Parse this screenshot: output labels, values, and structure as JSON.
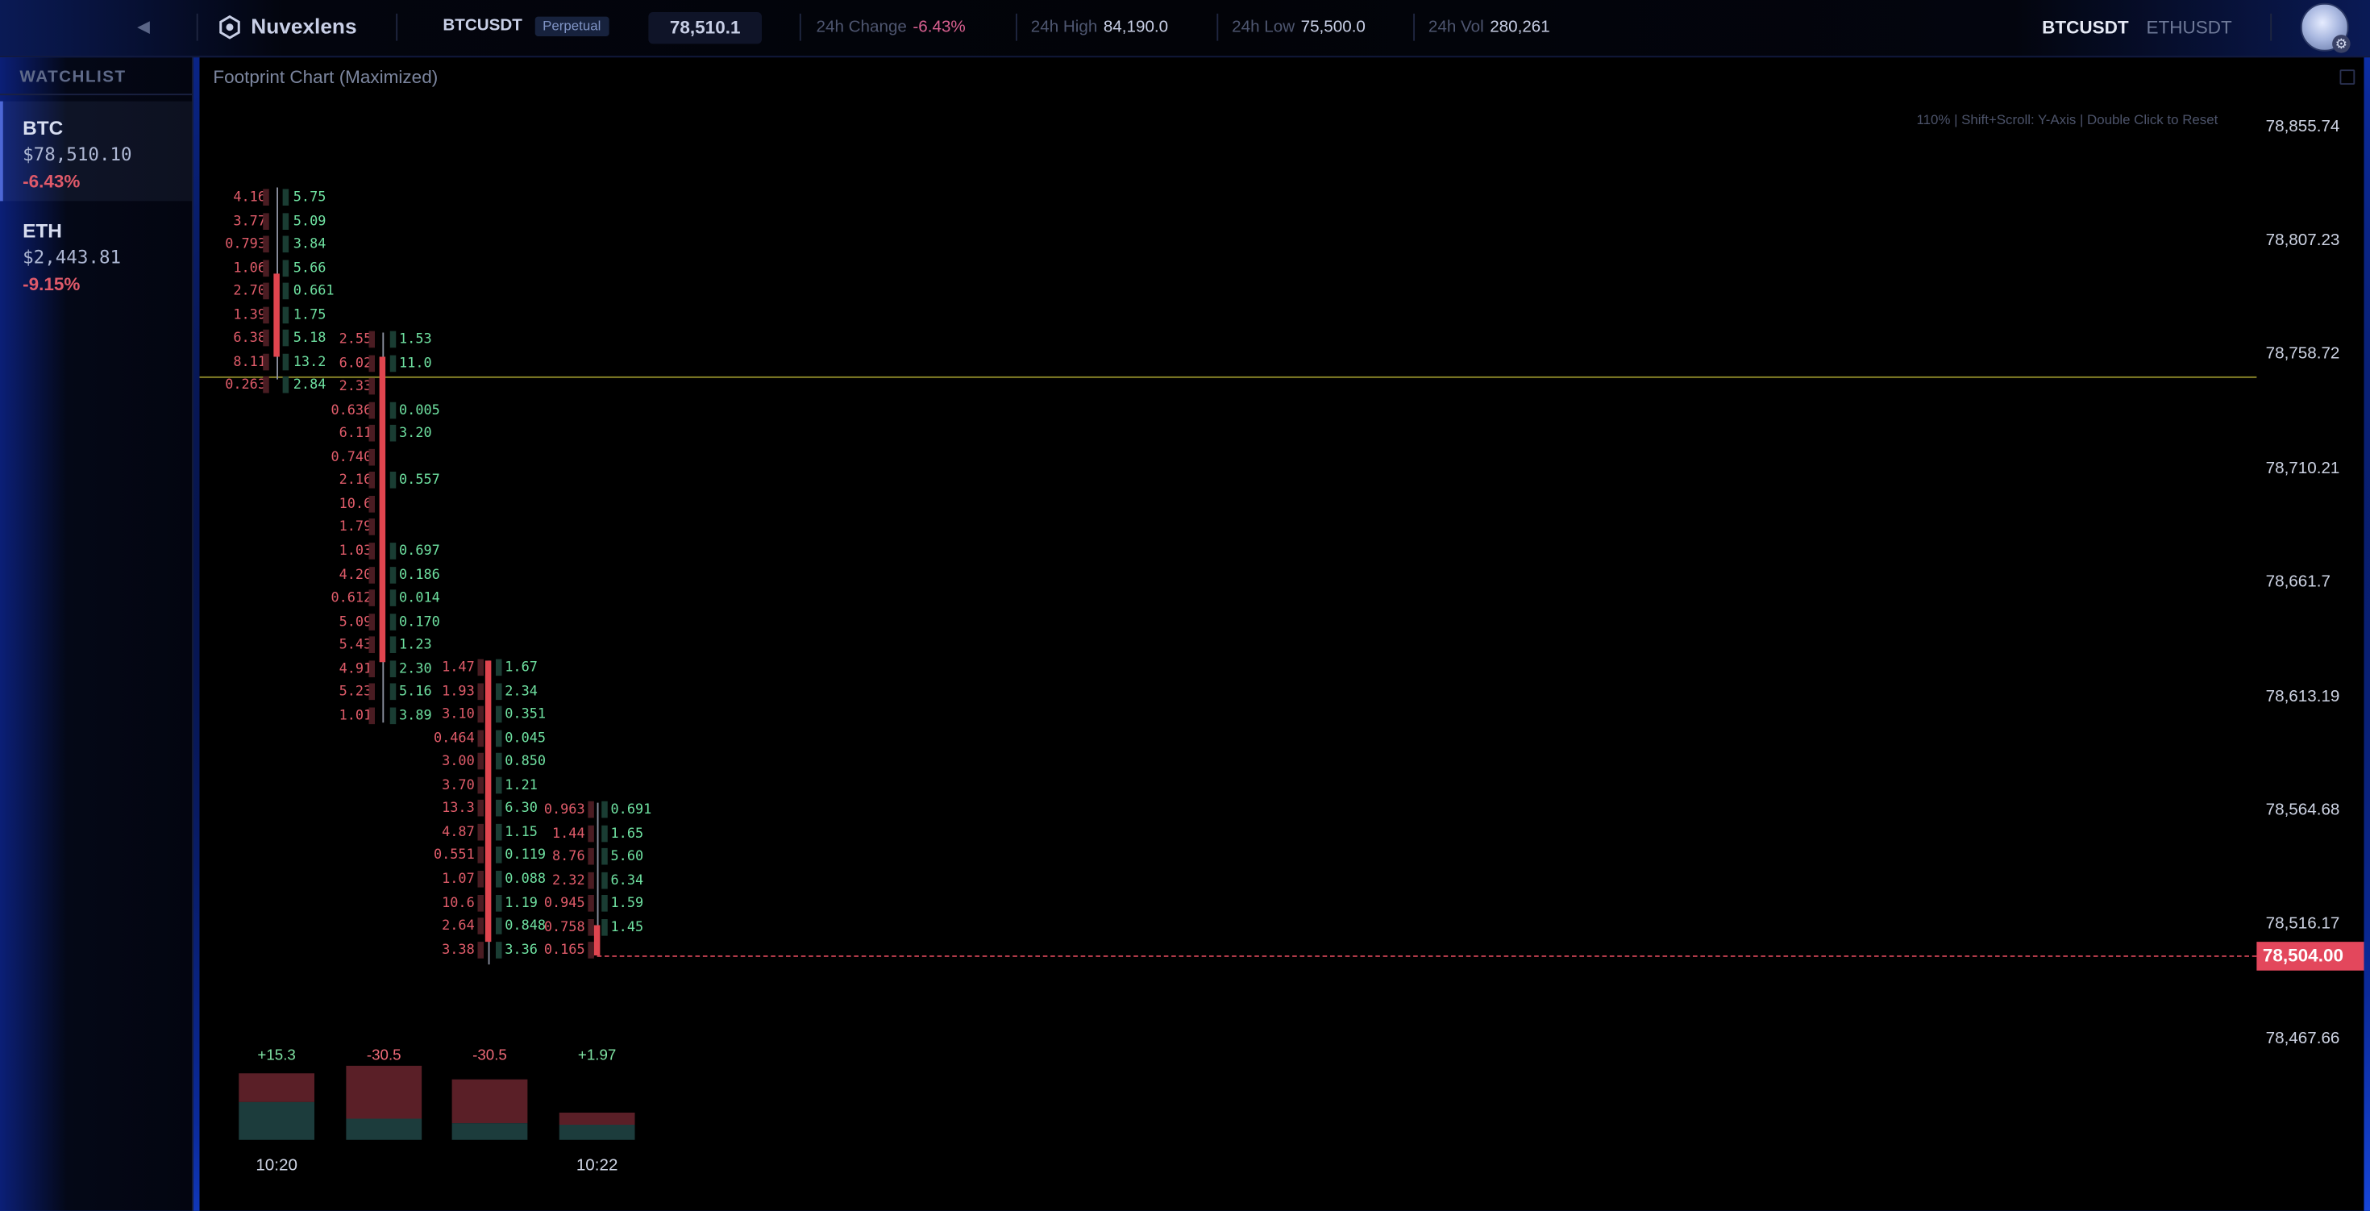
{
  "topbar": {
    "brand": "Nuvexlens",
    "symbol": "BTCUSDT",
    "contract_type": "Perpetual",
    "last_price": "78,510.1",
    "stats": [
      {
        "label": "24h Change",
        "value": "-6.43%",
        "negative": true
      },
      {
        "label": "24h High",
        "value": "84,190.0"
      },
      {
        "label": "24h Low",
        "value": "75,500.0"
      },
      {
        "label": "24h Vol",
        "value": "280,261"
      }
    ],
    "symbol_tabs": [
      {
        "label": "BTCUSDT",
        "active": true
      },
      {
        "label": "ETHUSDT",
        "active": false
      }
    ]
  },
  "watchlist": {
    "title": "WATCHLIST",
    "items": [
      {
        "symbol": "BTC",
        "price": "$78,510.10",
        "change": "-6.43%",
        "active": true
      },
      {
        "symbol": "ETH",
        "price": "$2,443.81",
        "change": "-9.15%",
        "active": false
      }
    ]
  },
  "chart": {
    "title": "Footprint Chart (Maximized)",
    "hint": "110% | Shift+Scroll: Y-Axis | Double Click to Reset",
    "y_ticks": [
      "78,855.74",
      "78,807.23",
      "78,758.72",
      "78,710.21",
      "78,661.7",
      "78,613.19",
      "78,564.68",
      "78,516.17",
      "78,467.66"
    ],
    "last_price_tag": "78,504.00",
    "colors": {
      "bid": "#e05c6a",
      "ask": "#6ee0a0",
      "candle_down": "#e0454f",
      "last_price": "#e3475c",
      "level_line": "#8f8a2a"
    }
  },
  "footprint": [
    {
      "bids": [
        "4.16",
        "3.77",
        "0.793",
        "1.06",
        "2.70",
        "1.39",
        "6.38",
        "8.11",
        "0.263"
      ],
      "asks": [
        "5.75",
        "5.09",
        "3.84",
        "5.66",
        "0.661",
        "1.75",
        "5.18",
        "13.2",
        "2.84"
      ]
    },
    {
      "bids": [
        "2.55",
        "6.02",
        "2.33",
        "0.636",
        "6.11",
        "0.740",
        "2.16",
        "10.6",
        "1.79",
        "1.03",
        "4.20",
        "0.612",
        "5.09",
        "5.43",
        "4.91",
        "5.23",
        "1.01"
      ],
      "asks": [
        "1.53",
        "11.0",
        "",
        "0.005",
        "3.20",
        "",
        "0.557",
        "",
        "",
        "0.697",
        "0.186",
        "0.014",
        "0.170",
        "1.23",
        "2.30",
        "5.16",
        "3.89"
      ]
    },
    {
      "bids": [
        "1.47",
        "1.93",
        "3.10",
        "0.464",
        "3.00",
        "3.70",
        "13.3",
        "4.87",
        "0.551",
        "1.07",
        "10.6",
        "2.64",
        "3.38"
      ],
      "asks": [
        "1.67",
        "2.34",
        "0.351",
        "0.045",
        "0.850",
        "1.21",
        "6.30",
        "1.15",
        "0.119",
        "0.088",
        "1.19",
        "0.848",
        "3.36"
      ]
    },
    {
      "bids": [
        "0.963",
        "1.44",
        "8.76",
        "2.32",
        "0.945",
        "0.758",
        "0.165"
      ],
      "asks": [
        "0.691",
        "1.65",
        "5.60",
        "6.34",
        "1.59",
        "1.45",
        ""
      ]
    }
  ],
  "volume_delta": {
    "deltas": [
      "+15.3",
      "-30.5",
      "-30.5",
      "+1.97"
    ],
    "sell_volume": [
      0.37,
      0.68,
      0.56,
      0.16
    ],
    "buy_volume": [
      0.48,
      0.27,
      0.21,
      0.19
    ],
    "time_labels": [
      "10:20",
      "",
      "",
      "10:22"
    ]
  }
}
